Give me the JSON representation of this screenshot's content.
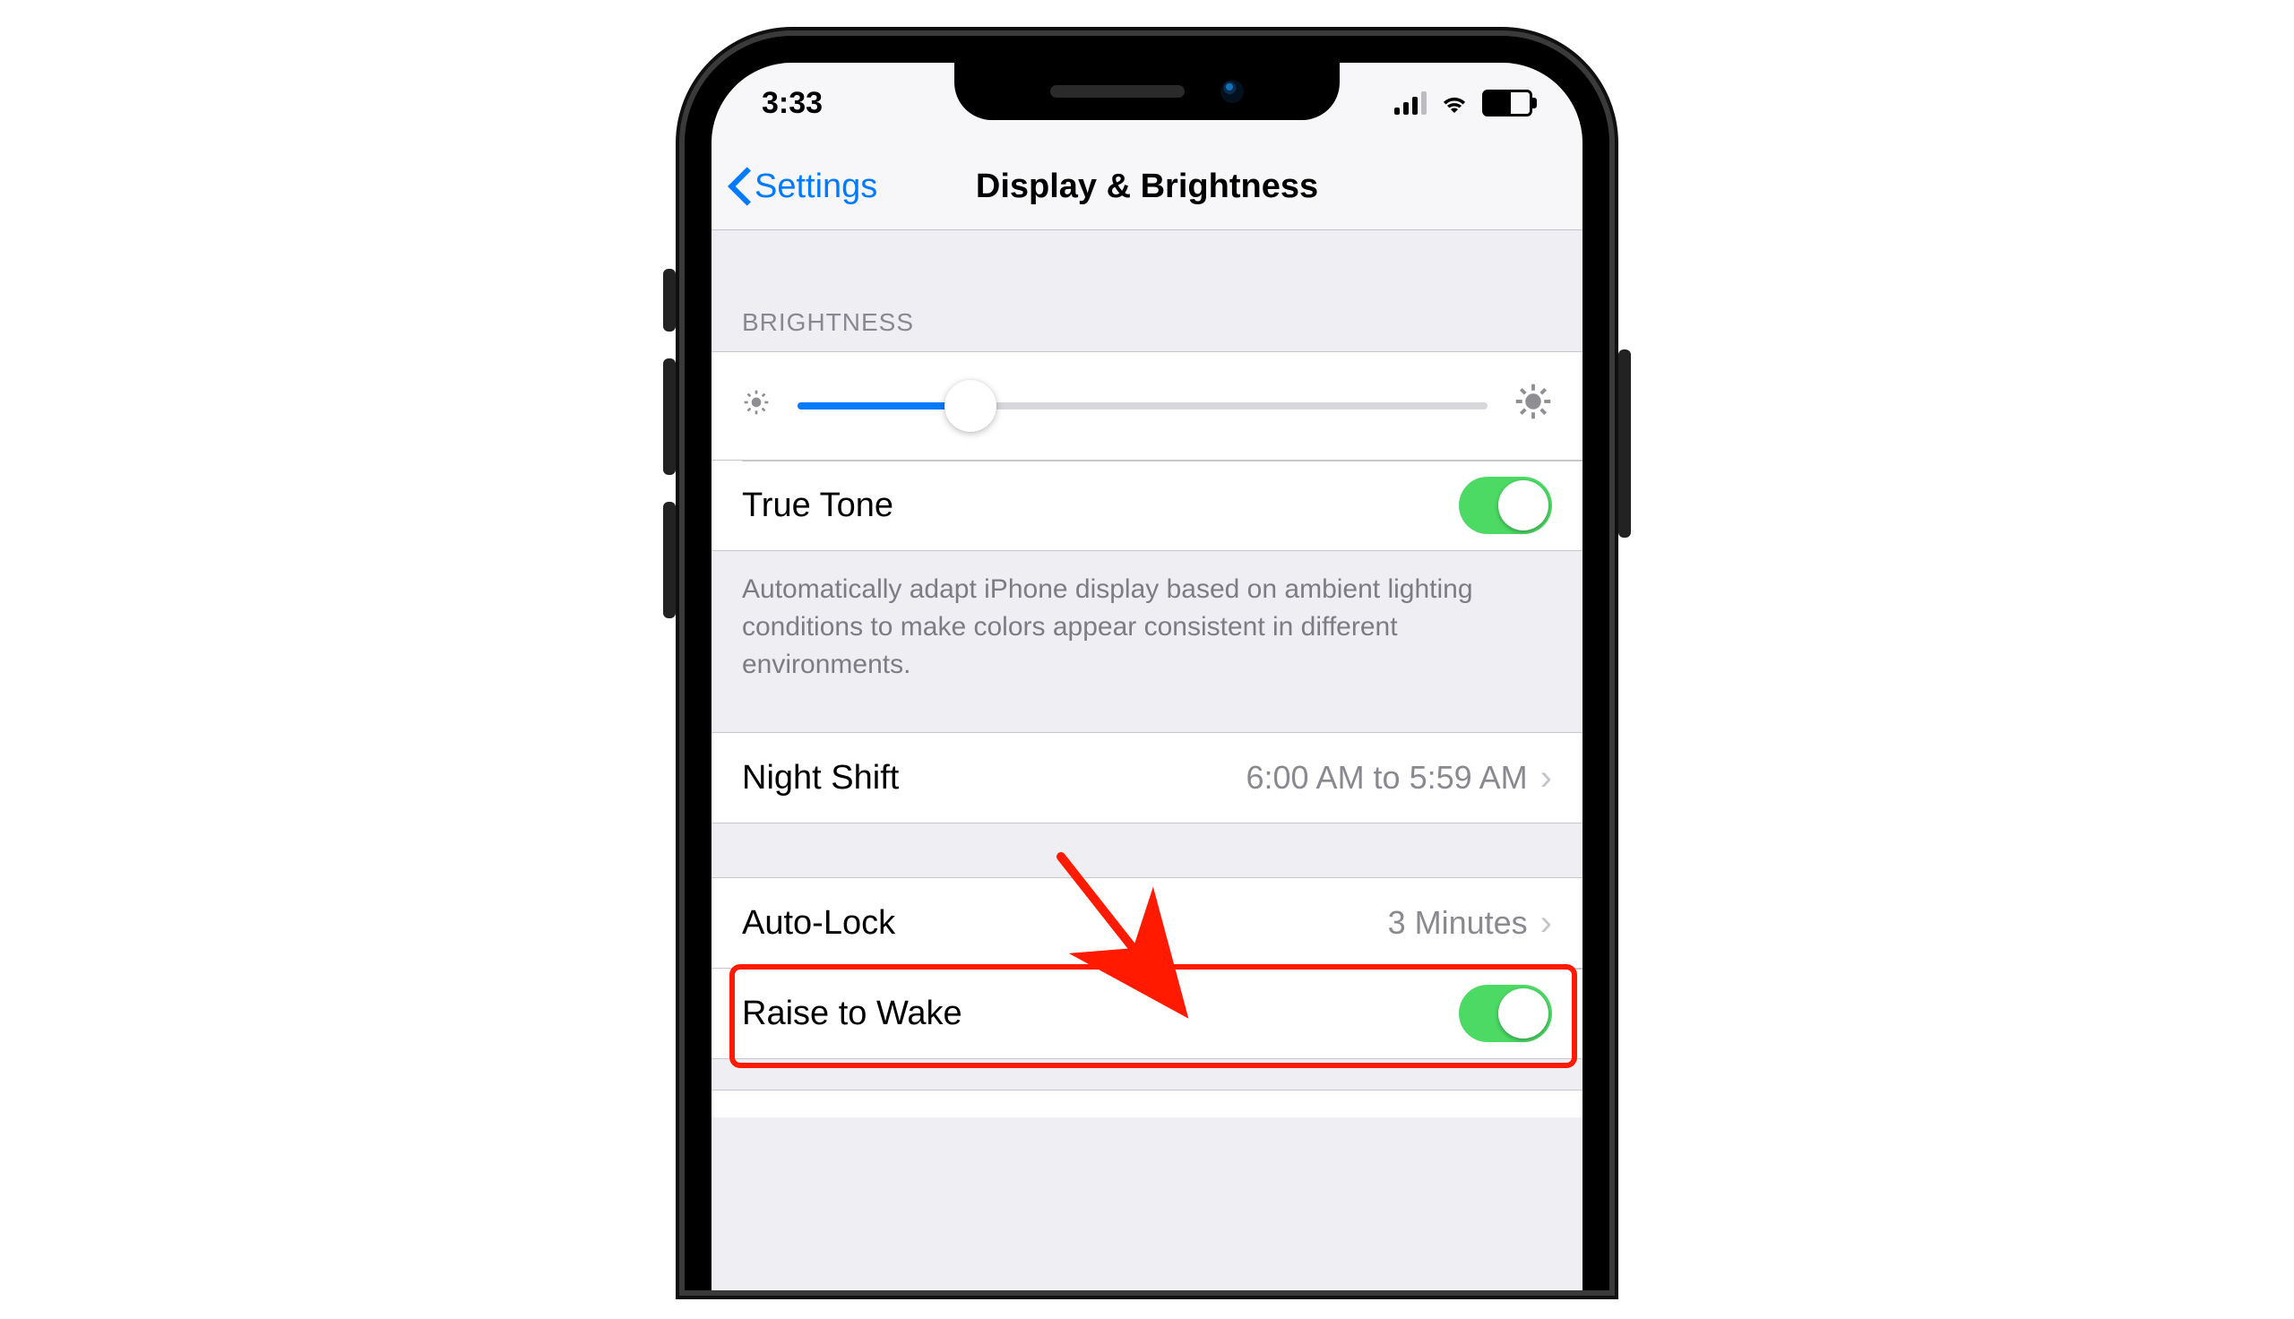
{
  "status": {
    "time": "3:33"
  },
  "nav": {
    "back": "Settings",
    "title": "Display & Brightness"
  },
  "brightness": {
    "header": "BRIGHTNESS",
    "level_percent": 25
  },
  "true_tone": {
    "label": "True Tone",
    "on": true
  },
  "true_tone_desc": "Automatically adapt iPhone display based on ambient lighting conditions to make colors appear consistent in different environments.",
  "night_shift": {
    "label": "Night Shift",
    "value": "6:00 AM to 5:59 AM"
  },
  "auto_lock": {
    "label": "Auto-Lock",
    "value": "3 Minutes"
  },
  "raise_to_wake": {
    "label": "Raise to Wake",
    "on": true
  }
}
